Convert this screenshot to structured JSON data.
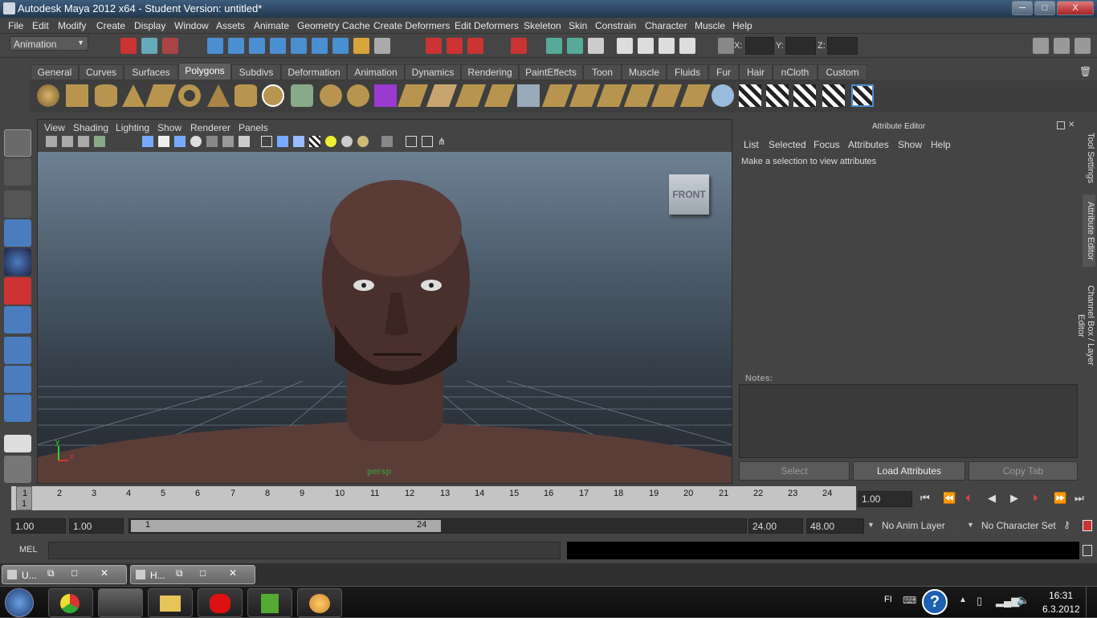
{
  "window": {
    "title": "Autodesk Maya 2012 x64 - Student Version: untitled*",
    "min_label": "─",
    "max_label": "□",
    "close_label": "X"
  },
  "menubar": [
    "File",
    "Edit",
    "Modify",
    "Create",
    "Display",
    "Window",
    "Assets",
    "Animate",
    "Geometry Cache",
    "Create Deformers",
    "Edit Deformers",
    "Skeleton",
    "Skin",
    "Constrain",
    "Character",
    "Muscle",
    "Help"
  ],
  "statusline": {
    "mode": "Animation",
    "x_label": "X:",
    "y_label": "Y:",
    "z_label": "Z:"
  },
  "shelf_tabs": [
    "General",
    "Curves",
    "Surfaces",
    "Polygons",
    "Subdivs",
    "Deformation",
    "Animation",
    "Dynamics",
    "Rendering",
    "PaintEffects",
    "Toon",
    "Muscle",
    "Fluids",
    "Fur",
    "Hair",
    "nCloth",
    "Custom"
  ],
  "active_shelf_tab": "Polygons",
  "viewport": {
    "menu": [
      "View",
      "Shading",
      "Lighting",
      "Show",
      "Renderer",
      "Panels"
    ],
    "viewcube_label": "FRONT",
    "camera_label": "persp",
    "axis_y": "y",
    "axis_x": "x"
  },
  "attribute_editor": {
    "title": "Attribute Editor",
    "menu": [
      "List",
      "Selected",
      "Focus",
      "Attributes",
      "Show",
      "Help"
    ],
    "message": "Make a selection to view attributes",
    "notes_label": "Notes:",
    "buttons": [
      "Select",
      "Load Attributes",
      "Copy Tab"
    ]
  },
  "side_tabs": [
    "Tool Settings",
    "Attribute Editor",
    "Channel Box / Layer Editor"
  ],
  "timeline": {
    "ticks": [
      "1",
      "2",
      "3",
      "4",
      "5",
      "6",
      "7",
      "8",
      "9",
      "10",
      "11",
      "12",
      "13",
      "14",
      "15",
      "16",
      "17",
      "18",
      "19",
      "20",
      "21",
      "22",
      "23",
      "24"
    ],
    "current_frame_marker": "1",
    "current_frame": "1.00"
  },
  "range": {
    "start": "1.00",
    "range_start": "1.00",
    "slider_start": "1",
    "slider_end": "24",
    "range_end": "24.00",
    "end": "48.00",
    "anim_layer": "No Anim Layer",
    "character_set": "No Character Set"
  },
  "command": {
    "label": "MEL"
  },
  "minimized": [
    {
      "label": "U..."
    },
    {
      "label": "H..."
    }
  ],
  "taskbar": {
    "lang": "FI",
    "time": "16:31",
    "date": "6.3.2012"
  }
}
